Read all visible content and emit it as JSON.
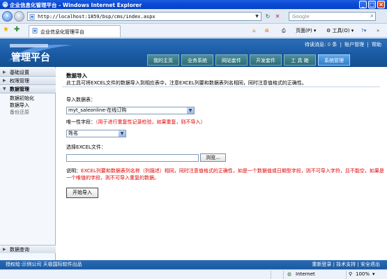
{
  "browser": {
    "title": "企业信息化管理平台 - Windows Internet Explorer",
    "url": "http://localhost:1859/bsp/cms/index.aspx",
    "search_placeholder": "Google",
    "tab_title": "企业信息化管理平台",
    "toolbar": {
      "page_label": "页面(P)",
      "tools_label": "工具(O)"
    },
    "status": {
      "zone": "Internet",
      "zoom": "100%"
    }
  },
  "app": {
    "logo_text": "管理平台",
    "userbar": {
      "prefix": "待读消息:",
      "count": "0",
      "unit": "条",
      "account": "账户管理",
      "help": "帮助"
    },
    "nav_tabs": [
      {
        "label": "我的主页"
      },
      {
        "label": "业务系统"
      },
      {
        "label": "网站套件"
      },
      {
        "label": "开发套件"
      },
      {
        "label": "工 具 箱"
      },
      {
        "label": "系统管理"
      }
    ],
    "sidebar": {
      "sections": [
        {
          "label": "基础设置"
        },
        {
          "label": "权限管理"
        },
        {
          "label": "数据管理"
        }
      ],
      "items": [
        {
          "label": "数据初始化"
        },
        {
          "label": "数据导入"
        },
        {
          "label": "备份还原"
        }
      ],
      "bottom_section": "数据查询"
    },
    "main": {
      "title": "数据导入",
      "description": "此工具可将EXCEL文件的数据导入到相应表中，注意EXCEL列要和数据表列名相同，同时注意值格式的正确性。",
      "table_label": "导入数据表：",
      "table_value": "myt_saleonline-在线订购",
      "unique_label": "唯一性字段：",
      "unique_note": "（用于进行重复性记录检验，如果重复，则不导入）",
      "unique_value": "姓名",
      "file_label": "选择EXCEL文件：",
      "browse_label": "浏览...",
      "note_prefix": "说明：",
      "note_text": "EXCEL列要和数据表列名称（列描述）相同，同时注意值格式的正确性，如是一个数据值或日期型字段，则不可导入字符，且不能空，如果是一个唯值的字段，则不可导入重复的数据。",
      "import_button": "开始导入"
    },
    "footer": {
      "left": "授权给:示例公司 天极国际软件出品",
      "right": "重新登录 | 技术支持 | 安全退出"
    }
  }
}
